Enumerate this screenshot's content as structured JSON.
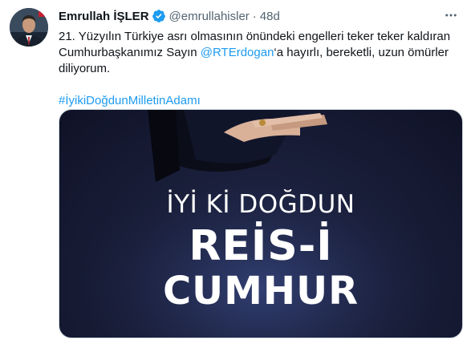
{
  "tweet": {
    "author_name": "Emrullah İŞLER",
    "author_handle": "@emrullahisler",
    "separator": "·",
    "time_ago": "48d",
    "text_part1": "21. Yüzyılın Türkiye asrı olmasının önündeki engelleri teker teker kaldıran Cumhurbaşkanımız Sayın ",
    "mention": "@RTErdogan",
    "text_part2": "‘a hayırlı, bereketli, uzun ömürler diliyorum.",
    "hashtag": "#İyikiDoğdunMilletinAdamı",
    "media": {
      "line1": "İYİ Kİ DOĞDUN",
      "line2": "REİS-İ",
      "line3": "CUMHUR"
    }
  },
  "icons": {
    "verified": "verified-badge-icon",
    "more": "more-icon"
  },
  "colors": {
    "link": "#1d9bf0",
    "secondary_text": "#536471",
    "media_background": "#1a1f3b"
  }
}
